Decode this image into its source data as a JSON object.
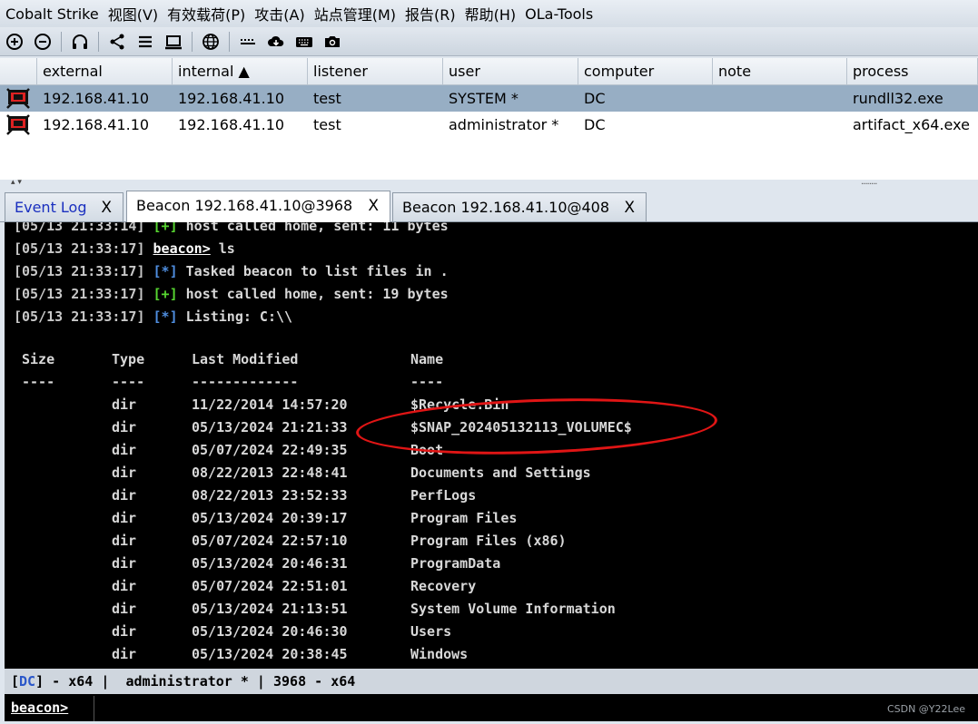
{
  "menu": [
    "Cobalt Strike",
    "视图(V)",
    "有效载荷(P)",
    "攻击(A)",
    "站点管理(M)",
    "报告(R)",
    "帮助(H)",
    "OLa-Tools"
  ],
  "toolbar_icons": [
    "plus-circle-icon",
    "minus-circle-icon",
    "headphones-icon",
    "share-icon",
    "list-icon",
    "monitor-icon",
    "globe-icon",
    "dots-bar-icon",
    "cloud-download-icon",
    "keyboard-icon",
    "camera-icon"
  ],
  "sessions": {
    "columns": [
      "",
      "external",
      "internal ▲",
      "listener",
      "user",
      "computer",
      "note",
      "process"
    ],
    "rows": [
      {
        "external": "192.168.41.10",
        "internal": "192.168.41.10",
        "listener": "test",
        "user": "SYSTEM *",
        "computer": "DC",
        "note": "",
        "process": "rundll32.exe",
        "selected": true
      },
      {
        "external": "192.168.41.10",
        "internal": "192.168.41.10",
        "listener": "test",
        "user": "administrator *",
        "computer": "DC",
        "note": "",
        "process": "artifact_x64.exe",
        "selected": false
      }
    ]
  },
  "tabs": [
    {
      "title": "Event Log",
      "close": "X"
    },
    {
      "title": "Beacon 192.168.41.10@3968",
      "close": "X"
    },
    {
      "title": "Beacon 192.168.41.10@408",
      "close": "X"
    }
  ],
  "console": {
    "log": [
      {
        "ts": "[05/13 21:33:14]",
        "tag": "[+]",
        "kind": "ok",
        "text": "host called home, sent: 11 bytes"
      },
      {
        "ts": "[05/13 21:33:17]",
        "tag": "beacon>",
        "kind": "prompt",
        "text": "ls"
      },
      {
        "ts": "[05/13 21:33:17]",
        "tag": "[*]",
        "kind": "info",
        "text": "Tasked beacon to list files in ."
      },
      {
        "ts": "[05/13 21:33:17]",
        "tag": "[+]",
        "kind": "ok",
        "text": "host called home, sent: 19 bytes"
      },
      {
        "ts": "[05/13 21:33:17]",
        "tag": "[*]",
        "kind": "info",
        "text": "Listing: C:\\\\"
      }
    ],
    "listing_headers": [
      "Size",
      "Type",
      "Last Modified",
      "Name"
    ],
    "listing_dashes": [
      "----",
      "----",
      "-------------",
      "----"
    ],
    "files": [
      {
        "size": "",
        "type": "dir",
        "modified": "11/22/2014 14:57:20",
        "name": "$Recycle.Bin"
      },
      {
        "size": "",
        "type": "dir",
        "modified": "05/13/2024 21:21:33",
        "name": "$SNAP_202405132113_VOLUMEC$"
      },
      {
        "size": "",
        "type": "dir",
        "modified": "05/07/2024 22:49:35",
        "name": "Boot"
      },
      {
        "size": "",
        "type": "dir",
        "modified": "08/22/2013 22:48:41",
        "name": "Documents and Settings"
      },
      {
        "size": "",
        "type": "dir",
        "modified": "08/22/2013 23:52:33",
        "name": "PerfLogs"
      },
      {
        "size": "",
        "type": "dir",
        "modified": "05/13/2024 20:39:17",
        "name": "Program Files"
      },
      {
        "size": "",
        "type": "dir",
        "modified": "05/07/2024 22:57:10",
        "name": "Program Files (x86)"
      },
      {
        "size": "",
        "type": "dir",
        "modified": "05/13/2024 20:46:31",
        "name": "ProgramData"
      },
      {
        "size": "",
        "type": "dir",
        "modified": "05/07/2024 22:51:01",
        "name": "Recovery"
      },
      {
        "size": "",
        "type": "dir",
        "modified": "05/13/2024 21:13:51",
        "name": "System Volume Information"
      },
      {
        "size": "",
        "type": "dir",
        "modified": "05/13/2024 20:46:30",
        "name": "Users"
      },
      {
        "size": "",
        "type": "dir",
        "modified": "05/13/2024 20:38:45",
        "name": "Windows"
      }
    ]
  },
  "status": {
    "host": "DC",
    "arch": "x64",
    "user": "administrator *",
    "pid": "3968",
    "pid_arch": "x64"
  },
  "input": {
    "prompt": "beacon>",
    "value": ""
  },
  "watermark": "CSDN @Y22Lee",
  "colors": {
    "ok": "#57d631",
    "info": "#4f8ee0",
    "selected_row": "#97aec4",
    "annotation": "#e01515"
  }
}
